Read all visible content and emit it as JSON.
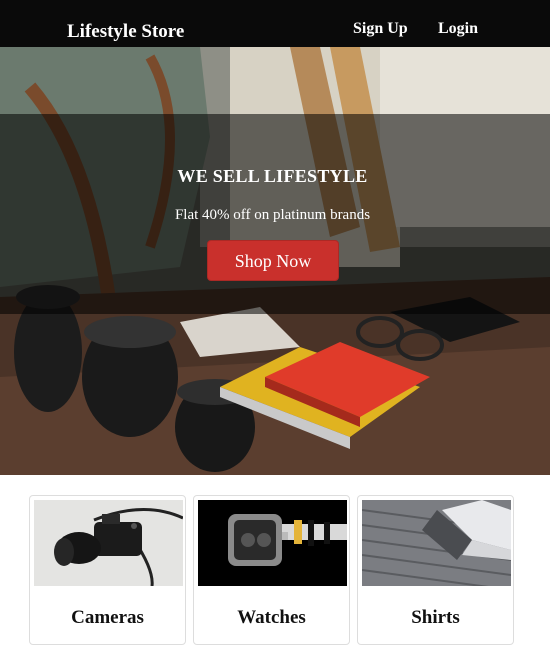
{
  "navbar": {
    "brand": "Lifestyle Store",
    "links": [
      {
        "label": "Sign Up"
      },
      {
        "label": "Login"
      }
    ]
  },
  "hero": {
    "title": "WE SELL LIFESTYLE",
    "subtitle": "Flat 40% off on platinum brands",
    "button_label": "Shop Now"
  },
  "products": [
    {
      "title": "Cameras"
    },
    {
      "title": "Watches"
    },
    {
      "title": "Shirts"
    }
  ],
  "colors": {
    "navbar_bg": "#0a0a0a",
    "accent_button": "#c9302c",
    "text_light": "#ffffff"
  }
}
